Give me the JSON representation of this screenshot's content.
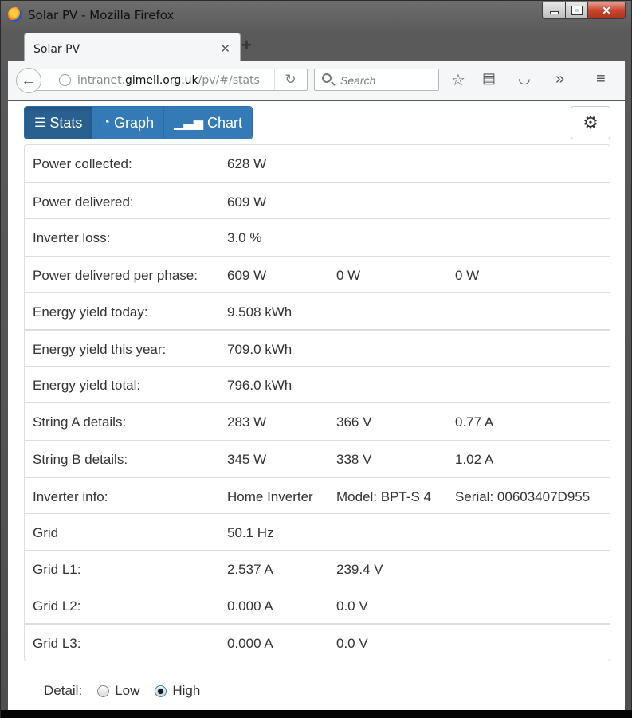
{
  "window": {
    "title": "Solar PV - Mozilla Firefox"
  },
  "tab": {
    "label": "Solar PV"
  },
  "nav": {
    "url_host": "intranet.gimell.org.uk",
    "url_path": "/pv/#/stats",
    "url_host_pre": "intranet.",
    "url_host_main": "gimell.org.uk",
    "search_placeholder": "Search"
  },
  "toolbar": {
    "stats_label": "Stats",
    "graph_label": "Graph",
    "chart_label": "Chart"
  },
  "stats": [
    {
      "label": "Power collected:",
      "v1": "628 W",
      "v2": "",
      "v3": ""
    },
    {
      "label": "Power delivered:",
      "v1": "609 W",
      "v2": "",
      "v3": ""
    },
    {
      "label": "Inverter loss:",
      "v1": "3.0 %",
      "v2": "",
      "v3": ""
    },
    {
      "label": "Power delivered per phase:",
      "v1": "609 W",
      "v2": "0 W",
      "v3": "0 W"
    },
    {
      "label": "Energy yield today:",
      "v1": "9.508 kWh",
      "v2": "",
      "v3": ""
    },
    {
      "label": "Energy yield this year:",
      "v1": "709.0 kWh",
      "v2": "",
      "v3": ""
    },
    {
      "label": "Energy yield total:",
      "v1": "796.0 kWh",
      "v2": "",
      "v3": ""
    },
    {
      "label": "String A details:",
      "v1": "283 W",
      "v2": "366 V",
      "v3": "0.77 A"
    },
    {
      "label": "String B details:",
      "v1": "345 W",
      "v2": "338 V",
      "v3": "1.02 A"
    },
    {
      "label": "Inverter info:",
      "v1": "Home Inverter",
      "v2": "Model: BPT-S 4",
      "v3": "Serial: 00603407D955"
    },
    {
      "label": "Grid",
      "v1": "50.1 Hz",
      "v2": "",
      "v3": ""
    },
    {
      "label": "Grid L1:",
      "v1": "2.537 A",
      "v2": "239.4 V",
      "v3": ""
    },
    {
      "label": "Grid L2:",
      "v1": "0.000 A",
      "v2": "0.0 V",
      "v3": ""
    },
    {
      "label": "Grid L3:",
      "v1": "0.000 A",
      "v2": "0.0 V",
      "v3": ""
    }
  ],
  "detail": {
    "label": "Detail:",
    "low_label": "Low",
    "high_label": "High",
    "selected": "High"
  },
  "colors": {
    "primary": "#337ab7",
    "primary_active": "#286090"
  }
}
